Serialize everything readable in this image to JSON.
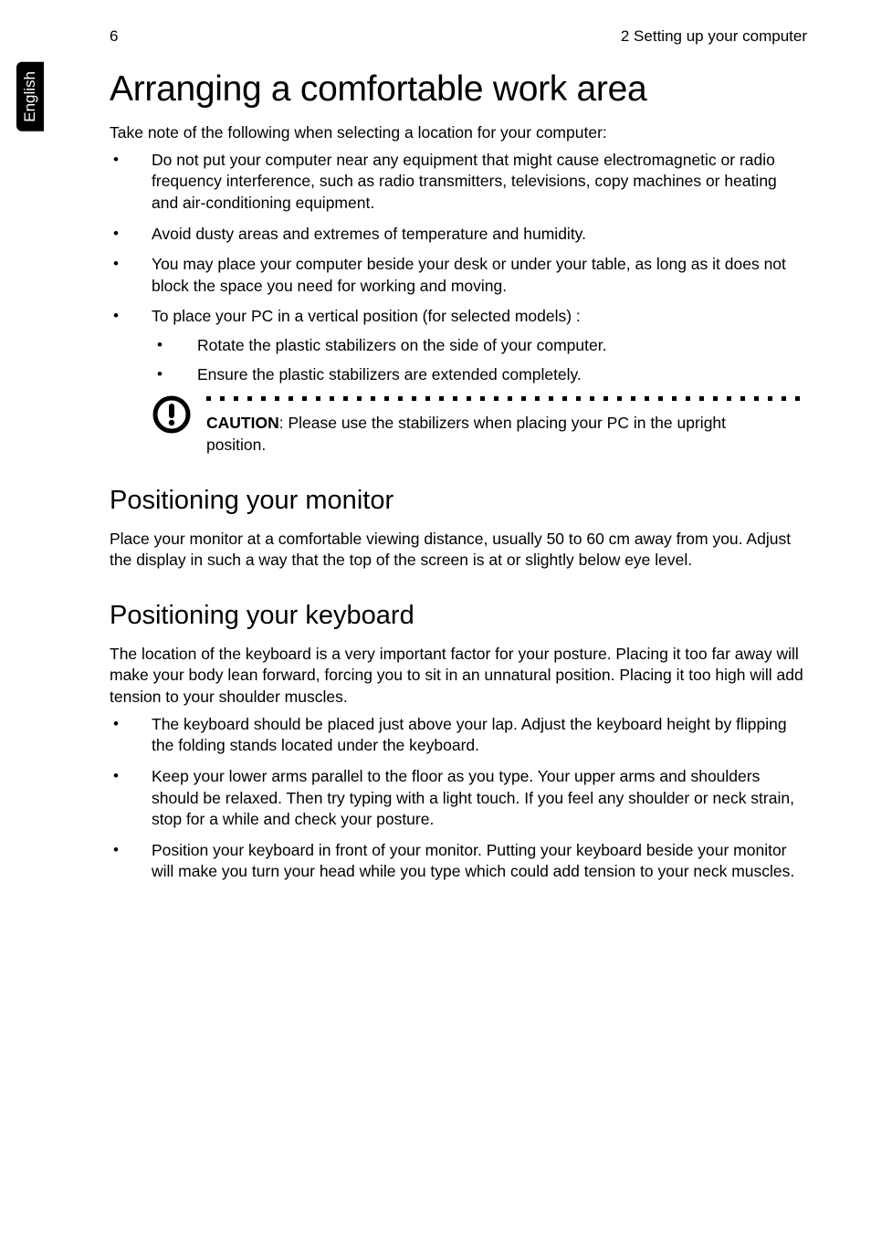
{
  "header": {
    "page_number": "6",
    "chapter": "2 Setting up your computer"
  },
  "side_tab": "English",
  "title": "Arranging a comfortable work area",
  "intro": "Take note of the following when selecting a location for your computer:",
  "bullets1": [
    "Do not put your computer near any equipment that might cause electromagnetic or radio frequency interference, such as radio transmitters, televisions, copy machines or heating and air-conditioning equipment.",
    "Avoid dusty areas and extremes of temperature and humidity.",
    "You may place your computer beside your desk or under your table, as long as it does not block the space you need for working and moving.",
    "To place your PC in a vertical position (for selected models) :"
  ],
  "bullets1_sub": [
    "Rotate the plastic stabilizers on the side of your computer.",
    "Ensure the plastic stabilizers are extended completely."
  ],
  "caution": {
    "label": "CAUTION",
    "text": ": Please use the stabilizers when placing your PC in the upright position."
  },
  "section_monitor": {
    "heading": "Positioning your monitor",
    "body": "Place your monitor at a comfortable viewing distance, usually 50 to 60 cm away from you. Adjust the display in such a way that the top of the screen is at or slightly below eye level."
  },
  "section_keyboard": {
    "heading": "Positioning your keyboard",
    "body": "The location of the keyboard is a very important factor for your posture. Placing it too far away will make your body lean forward, forcing you to sit in an unnatural position. Placing it too high will add tension to your shoulder muscles.",
    "bullets": [
      "The keyboard should be placed just above your lap. Adjust the keyboard height by flipping the folding stands located under the keyboard.",
      "Keep your lower arms parallel to the floor as you type. Your upper arms and shoulders should be relaxed. Then try typing with a light touch. If you feel any shoulder or neck strain, stop for a while and check your posture.",
      "Position your keyboard in front of your monitor. Putting your keyboard beside your monitor will make you turn your head while you type which could add tension to your neck muscles."
    ]
  }
}
